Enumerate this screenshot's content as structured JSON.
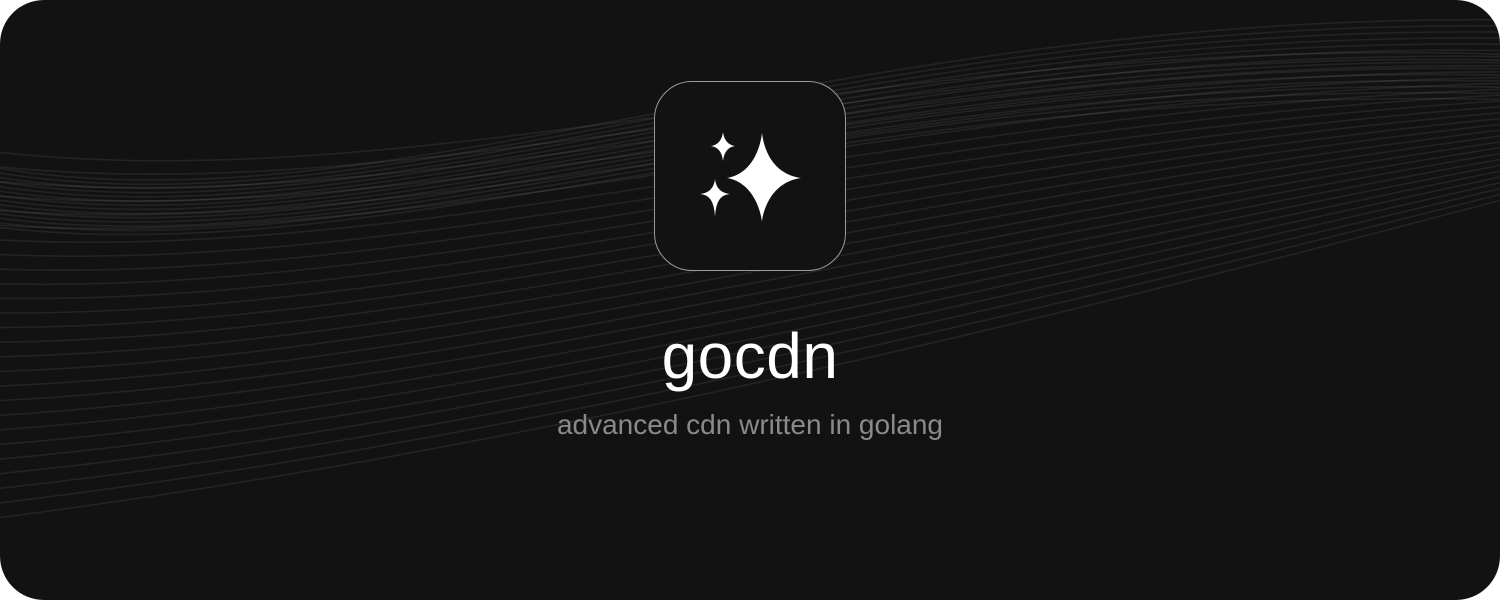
{
  "app": {
    "title": "gocdn",
    "tagline": "advanced cdn written in golang",
    "logo_icon": "sparkles-icon"
  },
  "colors": {
    "background": "#121212",
    "title": "#ffffff",
    "tagline": "#8a8a8a",
    "logo_border": "#9a9a9a"
  }
}
